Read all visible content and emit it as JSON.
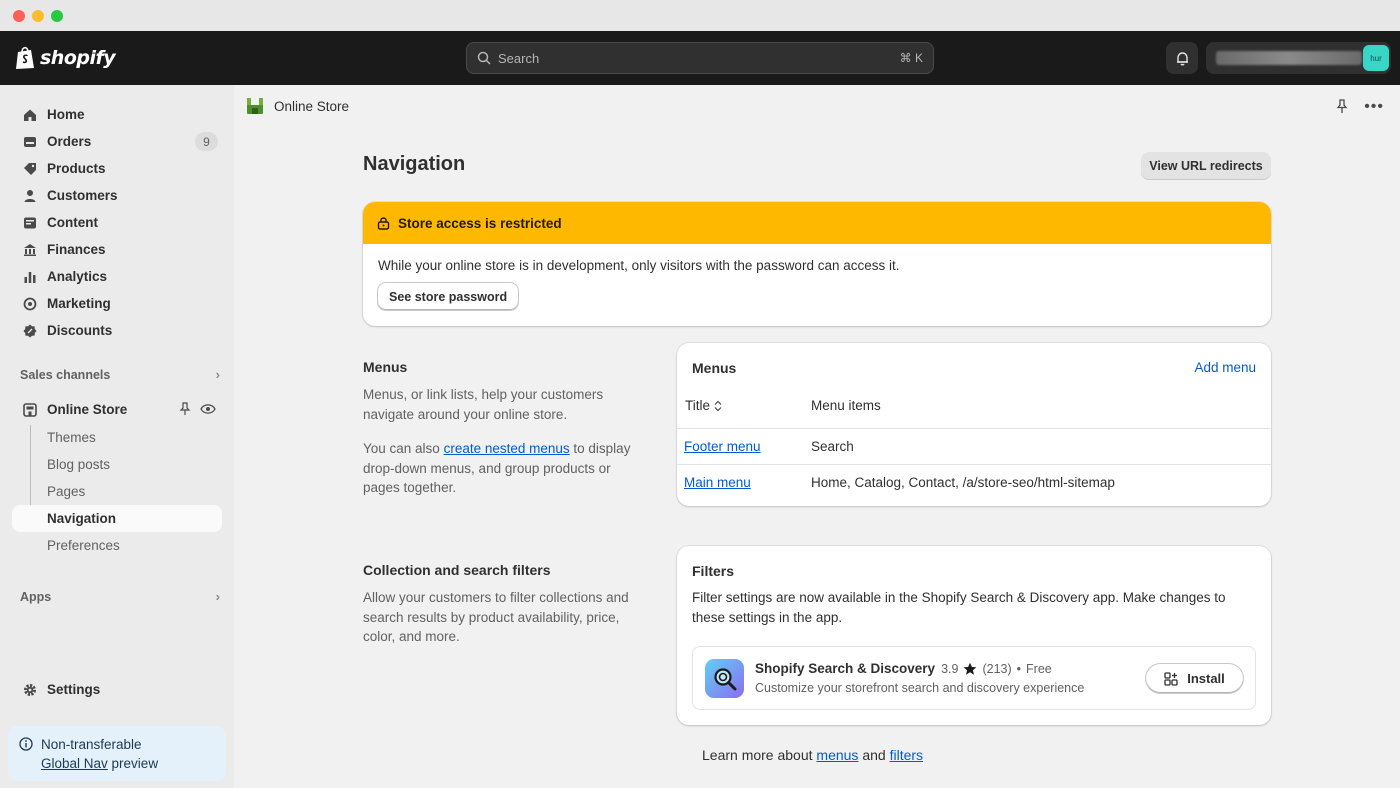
{
  "topbar": {
    "logo_text": "shopify",
    "search_placeholder": "Search",
    "search_shortcut": "⌘ K",
    "avatar_initials": "hur"
  },
  "sidebar": {
    "items": [
      {
        "label": "Home",
        "icon": "home-icon"
      },
      {
        "label": "Orders",
        "icon": "orders-icon",
        "badge": "9"
      },
      {
        "label": "Products",
        "icon": "tag-icon"
      },
      {
        "label": "Customers",
        "icon": "person-icon"
      },
      {
        "label": "Content",
        "icon": "content-icon"
      },
      {
        "label": "Finances",
        "icon": "bank-icon"
      },
      {
        "label": "Analytics",
        "icon": "bar-chart-icon"
      },
      {
        "label": "Marketing",
        "icon": "target-icon"
      },
      {
        "label": "Discounts",
        "icon": "discount-icon"
      }
    ],
    "sales_channels_label": "Sales channels",
    "online_store_label": "Online Store",
    "sub_items": [
      "Themes",
      "Blog posts",
      "Pages",
      "Navigation",
      "Preferences"
    ],
    "apps_label": "Apps",
    "settings_label": "Settings",
    "notice_line1": "Non-transferable",
    "notice_link": "Global Nav",
    "notice_line2": " preview"
  },
  "main": {
    "breadcrumb": "Online Store",
    "title": "Navigation",
    "view_redirects": "View URL redirects",
    "banner": {
      "title": "Store access is restricted",
      "body": "While your online store is in development, only visitors with the password can access it.",
      "button": "See store password"
    },
    "menus_section": {
      "title": "Menus",
      "desc1": "Menus, or link lists, help your customers navigate around your online store.",
      "desc2_pre": "You can also ",
      "desc2_link": "create nested menus",
      "desc2_post": " to display drop-down menus, and group products or pages together."
    },
    "menus_card": {
      "title": "Menus",
      "add_link": "Add menu",
      "col_title": "Title",
      "col_items": "Menu items",
      "rows": [
        {
          "title": "Footer menu",
          "items": "Search"
        },
        {
          "title": "Main menu",
          "items": "Home, Catalog, Contact, /a/store-seo/html-sitemap"
        }
      ]
    },
    "filters_section": {
      "title": "Collection and search filters",
      "desc": "Allow your customers to filter collections and search results by product availability, price, color, and more."
    },
    "filters_card": {
      "title": "Filters",
      "text": "Filter settings are now available in the Shopify Search & Discovery app. Make changes to these settings in the app.",
      "app_name": "Shopify Search & Discovery",
      "rating": "3.9",
      "reviews": "(213)",
      "price": "Free",
      "app_desc": "Customize your storefront search and discovery experience",
      "install": "Install"
    },
    "learn_pre": "Learn more about ",
    "learn_menus": "menus",
    "learn_and": " and ",
    "learn_filters": "filters"
  }
}
